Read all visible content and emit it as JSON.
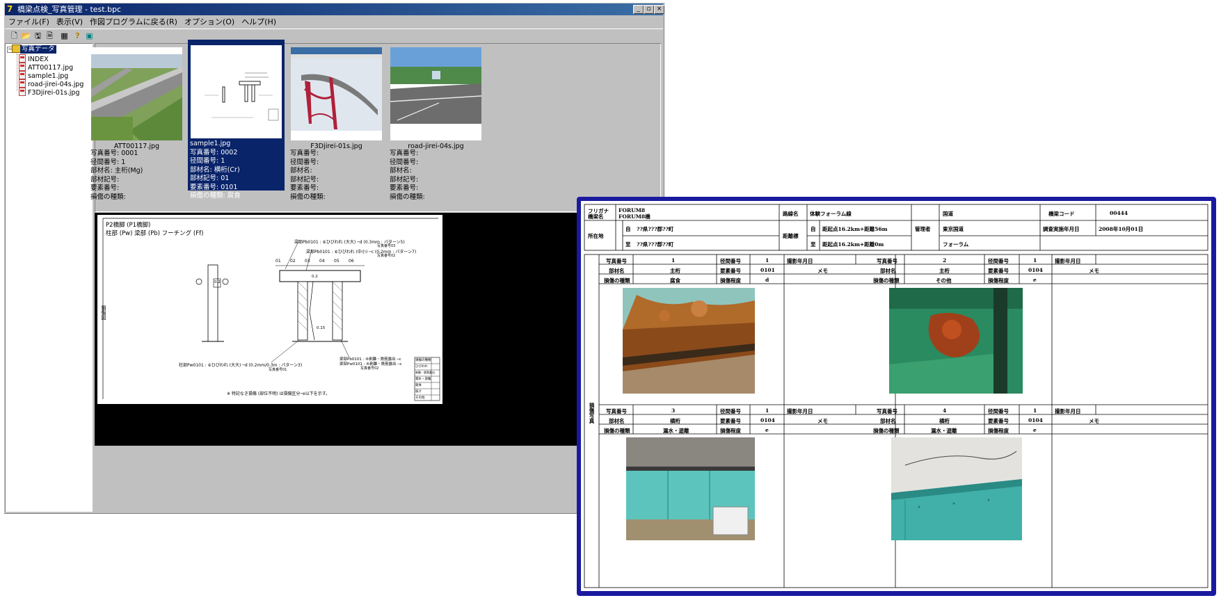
{
  "window": {
    "title": "橋梁点検_写真管理 - test.bpc",
    "buttons": {
      "minimize": "_",
      "maximize": "▫",
      "close": "×"
    }
  },
  "menu": [
    "ファイル(F)",
    "表示(V)",
    "作図プログラムに戻る(R)",
    "オプション(O)",
    "ヘルプ(H)"
  ],
  "toolbar": {
    "icons": [
      "new-icon",
      "open-icon",
      "save-icon",
      "copy-icon",
      "image-icon",
      "help-icon",
      "grid-icon"
    ],
    "glyphs": [
      "🗋",
      "📂",
      "🖫",
      "🗎",
      "▦",
      "?",
      "▣"
    ]
  },
  "tree": {
    "root": "写真データ",
    "items": [
      "INDEX",
      "ATT00117.jpg",
      "sample1.jpg",
      "road-jirei-04s.jpg",
      "F3Djirei-01s.jpg"
    ]
  },
  "thumbnails": [
    {
      "filename": "ATT00117.jpg",
      "meta": [
        "写真番号: 0001",
        "径間番号: 1",
        "部材名: 主桁(Mg)",
        "部材記号:",
        "要素番号:",
        "損傷の種類:"
      ],
      "selected": false
    },
    {
      "filename": "sample1.jpg",
      "meta": [
        "写真番号: 0002",
        "径間番号: 1",
        "部材名: 横桁(Cr)",
        "部材記号: 01",
        "要素番号: 0101",
        "損傷の種類: 腐食"
      ],
      "selected": true
    },
    {
      "filename": "F3Djirei-01s.jpg",
      "meta": [
        "写真番号:",
        "径間番号:",
        "部材名:",
        "部材記号:",
        "要素番号:",
        "損傷の種類:"
      ],
      "selected": false
    },
    {
      "filename": "road-jirei-04s.jpg",
      "meta": [
        "写真番号:",
        "径間番号:",
        "部材名:",
        "部材記号:",
        "要素番号:",
        "損傷の種類:"
      ],
      "selected": false
    }
  ],
  "drawing": {
    "heading1": "P2橋脚 (P1橋脚)",
    "heading2": "柱部 (Pw)  梁部 (Pb)  フーチング (Ff)",
    "callout1": "梁部Pb0101 : ⑥ひびわれ (大大) ─d (0.3mm : パターン5)",
    "callout1b": "写真番号03",
    "callout2": "梁部Pb0101 : ⑥ひびわれ (中小) ─c (0.2mm : パターン7)",
    "callout2b": "写真番号02",
    "callout3": "柱部Pw0101 : ⑥ひびわれ (大大) ─d (0.2mm/0.3m : パターン3)",
    "callout3b": "写真番号01",
    "callout4": "梁部Pb0101 : ⑥剥離・鉄筋露出 ─c",
    "callout4b": "梁部Pw0101 : ⑥剥離・鉄筋露出 ─c",
    "callout4c": "写真番号02",
    "labels": [
      "01",
      "02",
      "03",
      "04",
      "05",
      "06"
    ],
    "dim1": "0.2",
    "dim2": "0.15",
    "dim3": "0.2",
    "note": "※ 特記なき損傷 (部位不明) は損傷区分─e以下を示す。",
    "side": "損傷図",
    "legend": [
      "損傷の種類",
      "ひびわれ",
      "剥離・鉄筋露出",
      "漏水・遊離",
      "腐食",
      "抜け",
      "その他"
    ]
  },
  "report": {
    "furigana_label": "フリガナ",
    "bridge_label": "橋梁名",
    "furigana_value": "FORUM8",
    "bridge_value": "FORUM8橋",
    "route_label": "路線名",
    "route_value": "体験フォーラム線",
    "admin_label": "管理者",
    "owner_label": "国道",
    "office": "東京国道",
    "inspector": "フォーラム",
    "code_label": "橋梁コード",
    "code_value": "00444",
    "date_label": "調査実施年月日",
    "date_value": "2008年10月01日",
    "location_label": "所在地",
    "start_label": "自",
    "end_label": "至",
    "start_value": "??県???郡??町",
    "end_value": "??県???郡??町",
    "kilo_label": "距離標",
    "kilo_start": "距起点16.2km+距離56m",
    "kilo_end": "距起点16.2km+距離0m",
    "side_label": "損傷写真",
    "photos": [
      {
        "no": "1",
        "span": "1",
        "member": "主桁",
        "element": "0101",
        "damage": "腐食",
        "grade": "d",
        "memo": "メモ"
      },
      {
        "no": "2",
        "span": "1",
        "member": "主桁",
        "element": "0104",
        "damage": "その他",
        "grade": "e",
        "memo": "メモ"
      },
      {
        "no": "3",
        "span": "1",
        "member": "横桁",
        "element": "0104",
        "damage": "漏水・遊離",
        "grade": "e",
        "memo": "メモ"
      },
      {
        "no": "4",
        "span": "1",
        "member": "横桁",
        "element": "0104",
        "damage": "漏水・遊離",
        "grade": "e",
        "memo": "メモ"
      }
    ],
    "field_labels": {
      "photo_no": "写真番号",
      "span_no": "径間番号",
      "shot_date": "撮影年月日",
      "member": "部材名",
      "element": "要素番号",
      "damage": "損傷の種類",
      "grade": "損傷程度"
    }
  }
}
